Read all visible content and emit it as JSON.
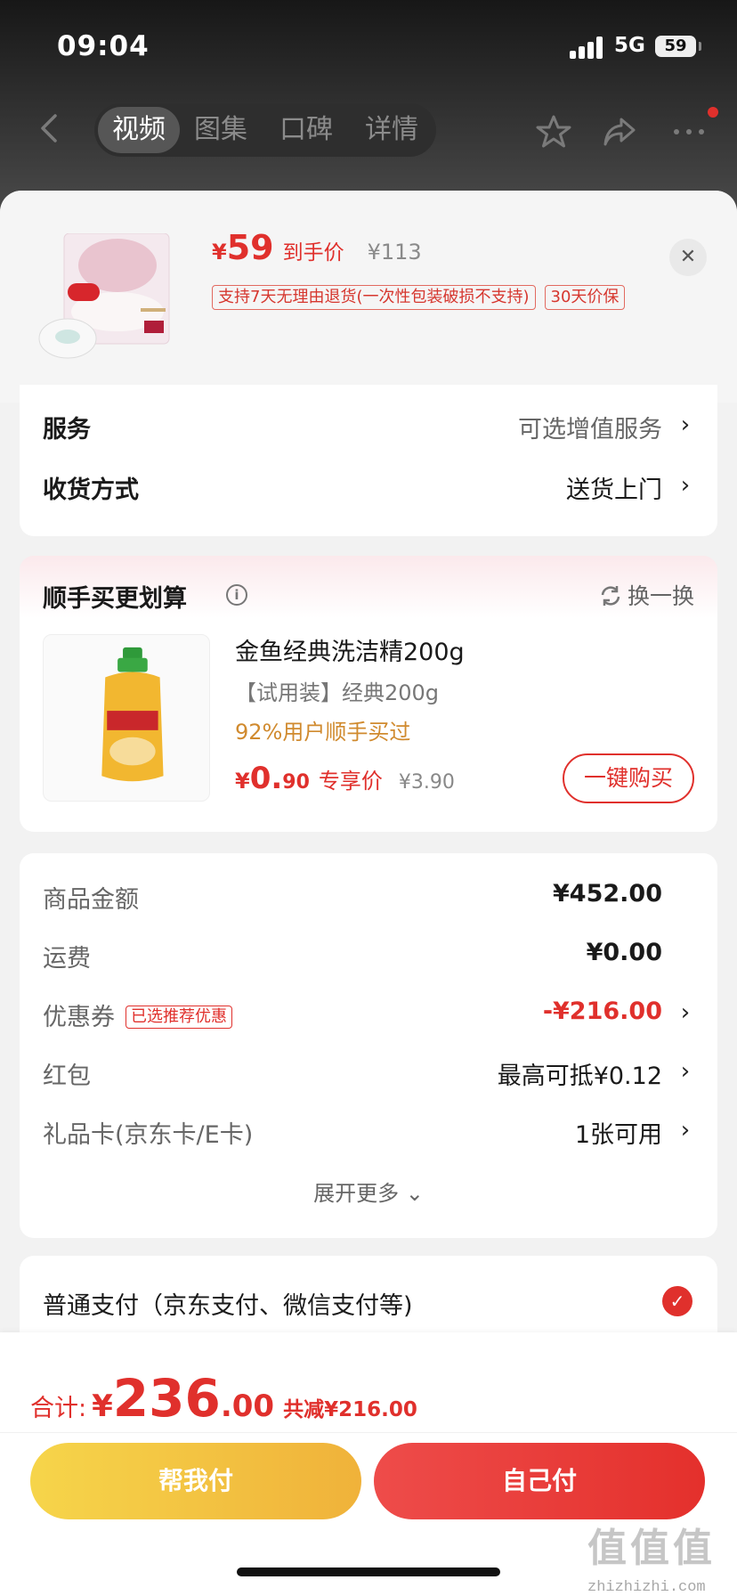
{
  "status": {
    "time": "09:04",
    "network": "5G",
    "battery": "59"
  },
  "nav": {
    "tabs": [
      {
        "label": "视频",
        "active": true
      },
      {
        "label": "图集"
      },
      {
        "label": "口碑"
      },
      {
        "label": "详情"
      }
    ]
  },
  "product": {
    "currency": "¥",
    "price": "59",
    "price_tag": "到手价",
    "original": "¥113",
    "tags": [
      "支持7天无理由退货(一次性包装破损不支持)",
      "30天价保"
    ]
  },
  "service": {
    "label": "服务",
    "value": "可选增值服务"
  },
  "delivery": {
    "label": "收货方式",
    "value": "送货上门"
  },
  "upsell": {
    "title": "顺手买更划算",
    "swap": "换一换",
    "name": "金鱼经典洗洁精200g",
    "spec": "【试用装】经典200g",
    "percent": "92%用户顺手买过",
    "currency": "¥",
    "price_int": "0.",
    "price_dec": "90",
    "price_tag": "专享价",
    "original": "¥3.90",
    "buy": "一键购买"
  },
  "summary": {
    "goods": {
      "label": "商品金额",
      "value": "¥452.00"
    },
    "shipping": {
      "label": "运费",
      "value": "¥0.00"
    },
    "coupon": {
      "label": "优惠券",
      "tag": "已选推荐优惠",
      "value": "-¥216.00"
    },
    "redpacket": {
      "label": "红包",
      "value": "最高可抵¥0.12"
    },
    "giftcard": {
      "label": "礼品卡(京东卡/E卡)",
      "value": "1张可用"
    },
    "expand": "展开更多"
  },
  "payment": {
    "label": "普通支付（京东支付、微信支付等)"
  },
  "bottom": {
    "total_label": "合计:",
    "currency": "¥",
    "total_int": "236",
    "total_dec": ".00",
    "save": "共减¥216.00",
    "help_pay": "帮我付",
    "self_pay": "自己付"
  },
  "watermark": {
    "logo": "值值值",
    "url": "zhizhizhi.com"
  },
  "colors": {
    "accent": "#e0302c",
    "help_button": "#f2c140",
    "self_button": "#e8403a"
  }
}
